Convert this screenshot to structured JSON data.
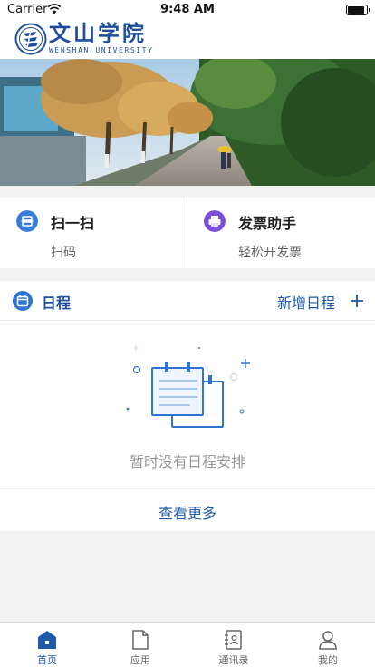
{
  "status_bar": {
    "carrier": "Carrier",
    "time": "9:48 AM",
    "battery_level": 0.9
  },
  "header": {
    "title": "文山学院",
    "subtitle": "WENSHAN UNIVERSITY",
    "logo_icon": "university-seal-icon"
  },
  "banner": {
    "image": "campus-tree-lined-path-photo"
  },
  "actions": [
    {
      "title": "扫一扫",
      "subtitle": "扫码",
      "icon": "scan-icon",
      "color": "#3a7bd5"
    },
    {
      "title": "发票助手",
      "subtitle": "轻松开发票",
      "icon": "invoice-printer-icon",
      "color": "#7b4fd8"
    }
  ],
  "schedule": {
    "title": "日程",
    "add_label": "新增日程",
    "empty_text": "暂时没有日程安排",
    "more_label": "查看更多",
    "accent": "#1e5aa8"
  },
  "tabs": [
    {
      "label": "首页",
      "icon": "home-icon",
      "active": true
    },
    {
      "label": "应用",
      "icon": "document-icon",
      "active": false
    },
    {
      "label": "通讯录",
      "icon": "contacts-book-icon",
      "active": false
    },
    {
      "label": "我的",
      "icon": "user-icon",
      "active": false
    }
  ]
}
